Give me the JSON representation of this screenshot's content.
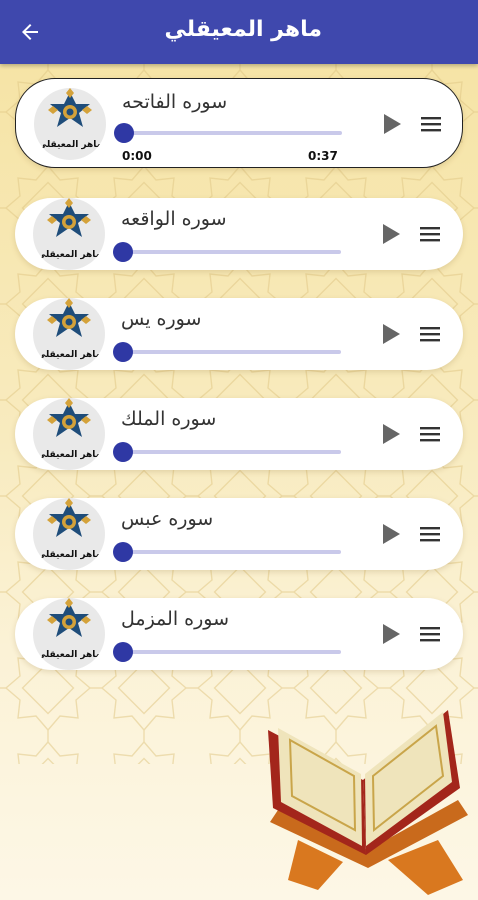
{
  "app_bar": {
    "title": "ماهر المعيقلي",
    "back_icon": "arrow-left-icon",
    "color": "#3f48ad"
  },
  "tracks": [
    {
      "name": "سوره الفاتحه",
      "avatar_caption": "ماهر المعيقلي",
      "progress": 0,
      "current_time": "0:00",
      "duration": "0:37",
      "active": true
    },
    {
      "name": "سوره الواقعه",
      "avatar_caption": "ماهر المعيقلي",
      "progress": 0,
      "active": false
    },
    {
      "name": "سوره يس",
      "avatar_caption": "ماهر المعيقلي",
      "progress": 0,
      "active": false
    },
    {
      "name": "سوره الملك",
      "avatar_caption": "ماهر المعيقلي",
      "progress": 0,
      "active": false
    },
    {
      "name": "سوره عبس",
      "avatar_caption": "ماهر المعيقلي",
      "progress": 0,
      "active": false
    },
    {
      "name": "سوره المزمل",
      "avatar_caption": "ماهر المعيقلي",
      "progress": 0,
      "active": false
    }
  ],
  "colors": {
    "accent": "#2f38a4",
    "track": "#c9c9ea",
    "icon": "#666666"
  },
  "icons": {
    "play": "play-icon",
    "menu": "menu-icon"
  }
}
